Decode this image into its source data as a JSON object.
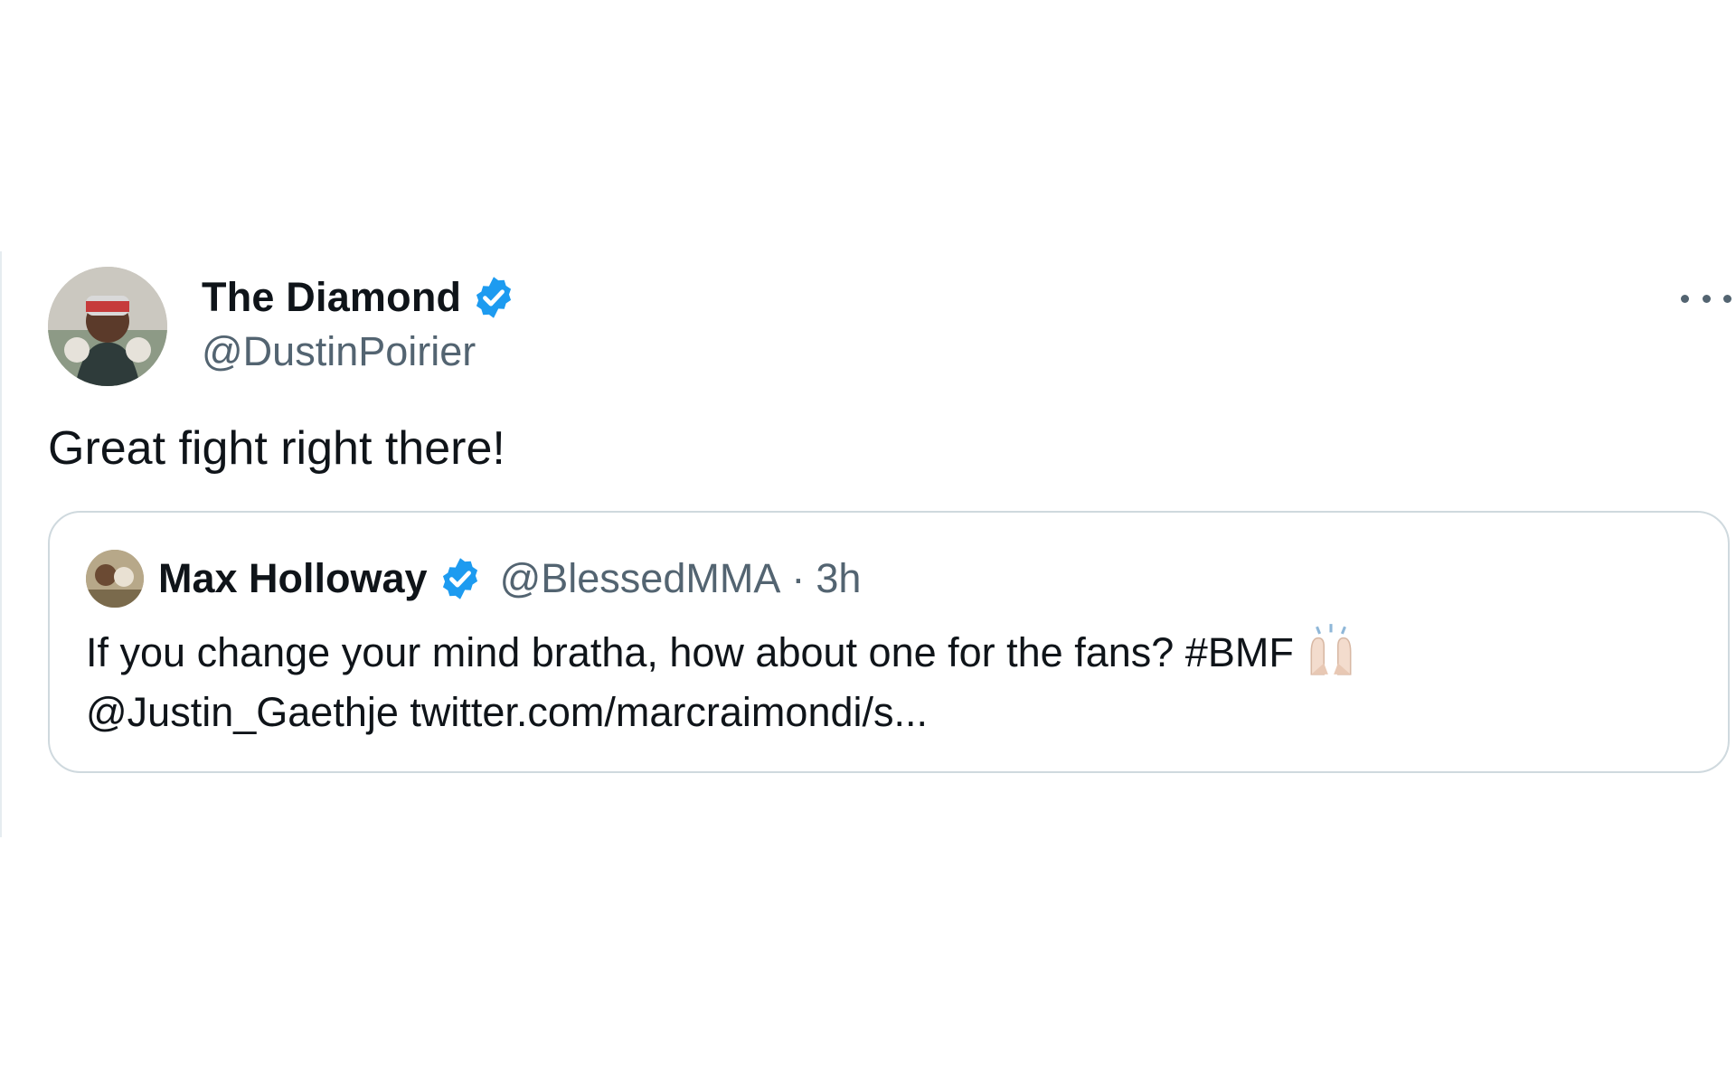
{
  "tweet": {
    "author": {
      "display_name": "The Diamond",
      "handle": "@DustinPoirier",
      "avatar_icon": "profile-photo"
    },
    "verified_icon": "verified-badge-icon",
    "more_icon": "more-options-icon",
    "text": "Great fight right there!"
  },
  "quoted_tweet": {
    "author": {
      "display_name": "Max Holloway",
      "handle": "@BlessedMMA",
      "avatar_icon": "profile-photo"
    },
    "separator": "·",
    "time": "3h",
    "text_line1": "If you change your mind bratha, how about one for the fans? #BMF",
    "emoji_icon": "raising-hands-emoji-icon",
    "text_line2": "@Justin_Gaethje twitter.com/marcraimondi/s..."
  },
  "colors": {
    "verified_blue": "#1d9bf0",
    "secondary_text": "#536471",
    "primary_text": "#0f1419",
    "border": "#cfd9de"
  }
}
